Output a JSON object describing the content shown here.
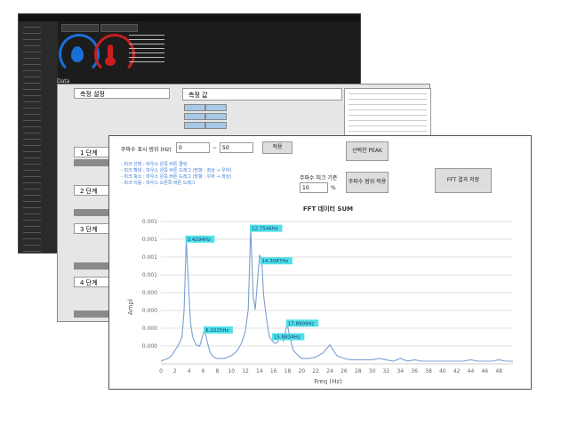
{
  "front": {
    "range_label": "주파수 표시 범위 (Hz)",
    "range_from": "0",
    "range_sep": "~",
    "range_to": "50",
    "apply_label": "적용",
    "hints": [
      "- 피크 선택 : 마우스 왼쪽 버튼 클릭",
      "- 피크 확대 : 마우스 왼쪽 버튼 드래그 (방향 : 좌상 → 우하)",
      "- 피크 축소 : 마우스 왼쪽 버튼 드래그 (방향 : 우하 → 좌상)",
      "- 피크 이동 : 마우스 오른쪽 버튼 드래그"
    ],
    "selected_peak_label": "선택한 PEAK",
    "threshold_label": "주파수 피크 기준",
    "threshold_value": "10",
    "threshold_unit": "%",
    "peak_range_apply_label": "주파수 범위 적용",
    "save_fft_label": "FFT 결과 저장"
  },
  "chart_data": {
    "type": "line",
    "title": "FFT 데이터 SUM",
    "xlabel": "Freq (Hz)",
    "ylabel": "Ampl",
    "xlim": [
      0,
      50
    ],
    "x_ticks": [
      0,
      2,
      4,
      6,
      8,
      10,
      12,
      14,
      16,
      18,
      20,
      22,
      24,
      26,
      28,
      30,
      32,
      34,
      36,
      38,
      40,
      42,
      44,
      46,
      48
    ],
    "y_tick_labels": [
      "0.001",
      "0.001",
      "0.001",
      "0.001",
      "0.000",
      "0.000",
      "0.000",
      "0.000"
    ],
    "grid": true,
    "line_color": "#7b9fd4",
    "series": [
      {
        "x": [
          0,
          0.5,
          1,
          1.5,
          2,
          2.5,
          3,
          3.3,
          3.6,
          3.9,
          4.2,
          4.5,
          5,
          5.5,
          6,
          6.2,
          6.5,
          7,
          7.5,
          8,
          8.5,
          9,
          9.5,
          10,
          10.5,
          11,
          11.5,
          12,
          12.4,
          12.75,
          13.1,
          13.4,
          13.7,
          14,
          14.3,
          14.6,
          15,
          15.4,
          15.8,
          16.2,
          16.6,
          17,
          17.4,
          17.9,
          18.3,
          18.8,
          19.5,
          20,
          21,
          22,
          23,
          23.5,
          24,
          24.5,
          25,
          26,
          27,
          28,
          29,
          30,
          31,
          32,
          33,
          34,
          35,
          36,
          37,
          38,
          39,
          40,
          41,
          42,
          43,
          44,
          45,
          46,
          47,
          48,
          49,
          50
        ],
        "y": [
          2e-05,
          3e-05,
          4e-05,
          6e-05,
          0.0001,
          0.00014,
          0.0002,
          0.0004,
          0.00092,
          0.0006,
          0.0003,
          0.0002,
          0.00014,
          0.00013,
          0.00022,
          0.00025,
          0.00018,
          8e-05,
          5e-05,
          4e-05,
          4e-05,
          4e-05,
          5e-05,
          6e-05,
          8e-05,
          0.00011,
          0.00016,
          0.00024,
          0.0004,
          0.001,
          0.0005,
          0.0004,
          0.0006,
          0.0008,
          0.00078,
          0.0005,
          0.00033,
          0.0002,
          0.00017,
          0.00015,
          0.00016,
          0.00022,
          0.00017,
          0.0003,
          0.0002,
          0.0001,
          6e-05,
          4e-05,
          4e-05,
          5e-05,
          8e-05,
          0.00011,
          0.00014,
          0.0001,
          6e-05,
          4e-05,
          3e-05,
          3e-05,
          3e-05,
          3e-05,
          4e-05,
          3e-05,
          2e-05,
          4e-05,
          2e-05,
          3e-05,
          2e-05,
          2e-05,
          2e-05,
          2e-05,
          2e-05,
          2e-05,
          2e-05,
          3e-05,
          2e-05,
          2e-05,
          2e-05,
          3e-05,
          2e-05,
          2e-05
        ]
      }
    ],
    "annotations": [
      {
        "label": "3.4294Hz",
        "x": 3.6,
        "y": 0.00092
      },
      {
        "label": "12.7546Hz",
        "x": 12.75,
        "y": 0.001
      },
      {
        "label": "14.3087Hz",
        "x": 14.2,
        "y": 0.00076
      },
      {
        "label": "6.2025Hz",
        "x": 6.2,
        "y": 0.00025
      },
      {
        "label": "17.8909Hz",
        "x": 17.9,
        "y": 0.0003
      },
      {
        "label": "15.8834Hz",
        "x": 15.9,
        "y": 0.0002
      }
    ]
  },
  "mid": {
    "header_label": "측정 설정",
    "table_label": "측정 값",
    "step1": "1 단계",
    "step2": "2 단계",
    "step3": "3 단계",
    "step4": "4 단계"
  },
  "dark": {
    "section_label": "Data"
  }
}
